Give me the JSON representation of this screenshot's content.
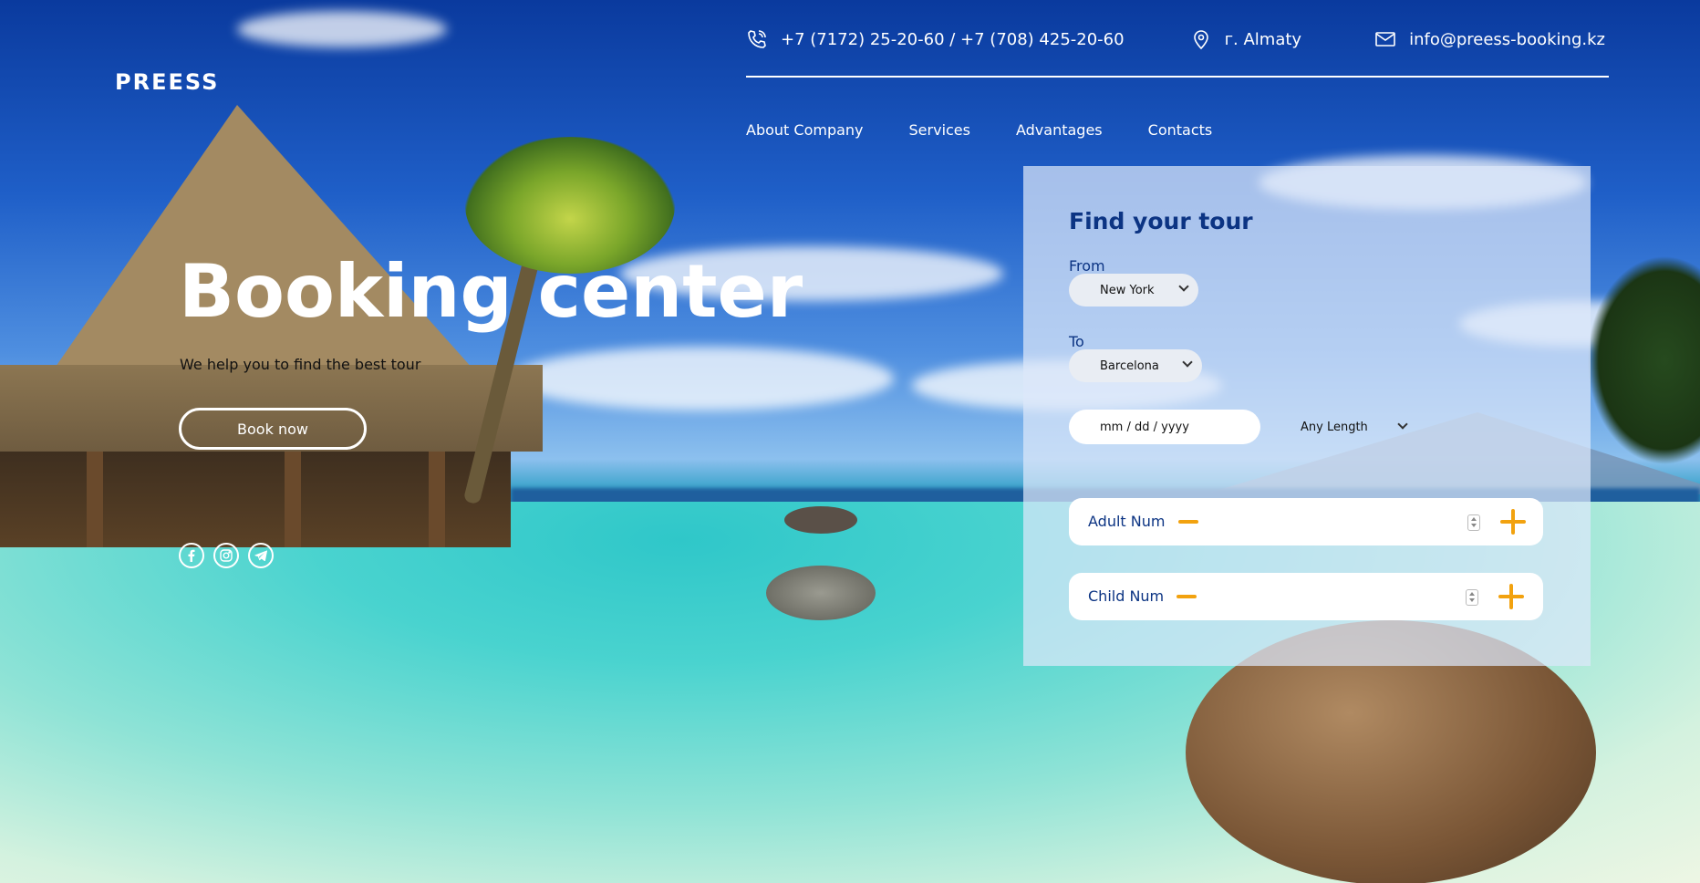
{
  "brand": {
    "logo": "PREESS"
  },
  "contacts": {
    "phone": "+7 (7172) 25-20-60 / +7 (708) 425-20-60",
    "location": "г. Almaty",
    "email": "info@preess-booking.kz"
  },
  "icons": {
    "phone": "phone-icon",
    "location": "location-pin-icon",
    "email": "mail-icon",
    "facebook": "facebook-icon",
    "instagram": "instagram-icon",
    "telegram": "telegram-icon"
  },
  "nav": {
    "items": [
      "About Company",
      "Services",
      "Advantages",
      "Contacts"
    ]
  },
  "hero": {
    "title": "Booking center",
    "subtitle": "We help you to find the best tour",
    "cta": "Book now"
  },
  "search": {
    "title": "Find your tour",
    "from_label": "From",
    "from_value": "New York",
    "to_label": "To",
    "to_value": "Barcelona",
    "date_placeholder": "mm / dd / yyyy",
    "length_value": "Any Length",
    "adult_label": "Adult Num",
    "child_label": "Child Num"
  },
  "colors": {
    "accent": "#f2a20f",
    "title_blue": "#0c3483",
    "panel": "#dce8fa"
  }
}
